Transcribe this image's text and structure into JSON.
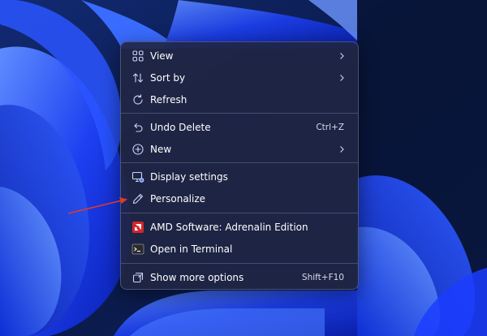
{
  "menu": {
    "items": [
      {
        "label": "View",
        "icon": "view-grid-icon",
        "submenu": true
      },
      {
        "label": "Sort by",
        "icon": "sort-icon",
        "submenu": true
      },
      {
        "label": "Refresh",
        "icon": "refresh-icon"
      },
      {
        "label": "Undo Delete",
        "icon": "undo-icon",
        "shortcut": "Ctrl+Z"
      },
      {
        "label": "New",
        "icon": "new-plus-icon",
        "submenu": true
      },
      {
        "label": "Display settings",
        "icon": "display-settings-icon"
      },
      {
        "label": "Personalize",
        "icon": "pen-icon"
      },
      {
        "label": "AMD Software: Adrenalin Edition",
        "icon": "amd-logo-icon"
      },
      {
        "label": "Open in Terminal",
        "icon": "terminal-icon"
      },
      {
        "label": "Show more options",
        "icon": "more-options-icon",
        "shortcut": "Shift+F10"
      }
    ]
  },
  "colors": {
    "menu_background": "#202642",
    "text": "#ffffff",
    "icon": "#cdd3f5",
    "amd_red": "#d4252b",
    "annotation_arrow": "#e0392d",
    "wallpaper_blue": "#1a3cff"
  }
}
